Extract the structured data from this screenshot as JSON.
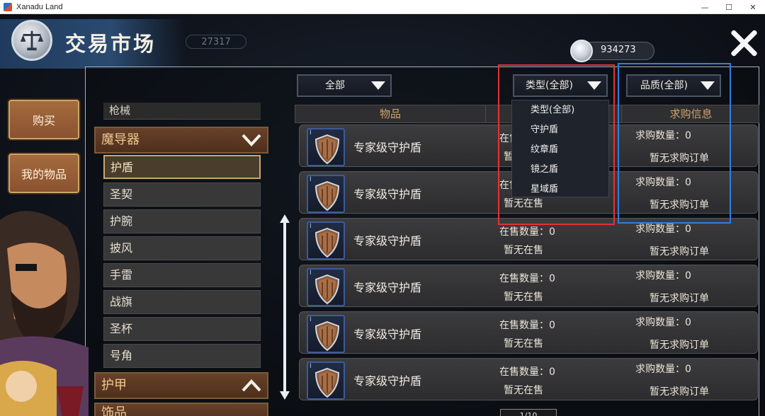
{
  "window": {
    "title": "Xanadu Land",
    "controls": [
      "—",
      "☐",
      "✕"
    ]
  },
  "header": {
    "title": "交易市场",
    "gold_counter": "27317",
    "currency_value": "934273"
  },
  "side_buttons": {
    "buy": "购买",
    "my_items": "我的物品"
  },
  "categories": {
    "top_partial": "枪械",
    "group_magic": "魔导器",
    "items": [
      "护盾",
      "圣契",
      "护腕",
      "披风",
      "手雷",
      "战旗",
      "圣杯",
      "号角"
    ],
    "selected_index": 0,
    "group_armor": "护甲",
    "group_accessory_partial": "饰品"
  },
  "filters": {
    "all": "全部",
    "type": "类型(全部)",
    "quality": "品质(全部)"
  },
  "table": {
    "col_item": "物品",
    "col_sell": "",
    "col_buy": "求购信息"
  },
  "rows": [
    {
      "name": "专家级守护盾",
      "sell_qty": "在售数量：0",
      "sell_none": "暂无在售",
      "buy_qty": "求购数量：0",
      "buy_none": "暂无求购订单",
      "tier": "I"
    },
    {
      "name": "专家级守护盾",
      "sell_qty": "在售数量：0",
      "sell_none": "暂无在售",
      "buy_qty": "求购数量：0",
      "buy_none": "暂无求购订单",
      "tier": "I"
    },
    {
      "name": "专家级守护盾",
      "sell_qty": "在售数量：0",
      "sell_none": "暂无在售",
      "buy_qty": "求购数量：0",
      "buy_none": "暂无求购订单",
      "tier": "I"
    },
    {
      "name": "专家级守护盾",
      "sell_qty": "在售数量：0",
      "sell_none": "暂无在售",
      "buy_qty": "求购数量：0",
      "buy_none": "暂无求购订单",
      "tier": "I"
    },
    {
      "name": "专家级守护盾",
      "sell_qty": "在售数量：0",
      "sell_none": "暂无在售",
      "buy_qty": "求购数量：0",
      "buy_none": "暂无求购订单",
      "tier": "I"
    },
    {
      "name": "专家级守护盾",
      "sell_qty": "在售数量：0",
      "sell_none": "暂无在售",
      "buy_qty": "求购数量：0",
      "buy_none": "暂无求购订单",
      "tier": "I"
    }
  ],
  "type_dropdown_options": [
    "类型(全部)",
    "守护盾",
    "纹章盾",
    "镜之盾",
    "星域盾"
  ],
  "pager": "1/10",
  "colors": {
    "accent_gold": "#cfa46b",
    "annotation_red": "#e63232",
    "annotation_blue": "#2f7fe0"
  }
}
